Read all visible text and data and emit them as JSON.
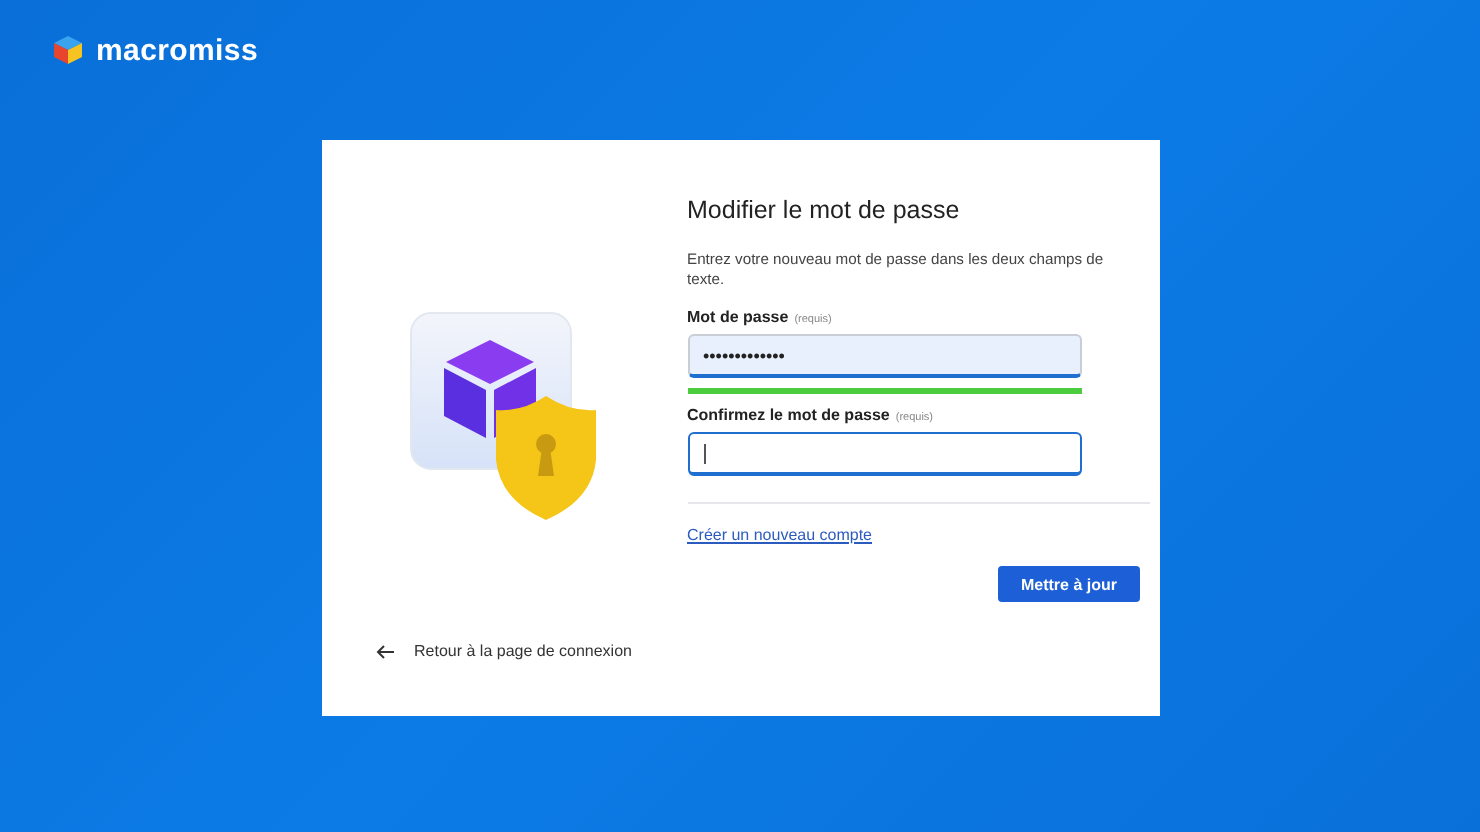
{
  "brand": {
    "name": "macromiss"
  },
  "form": {
    "title": "Modifier le mot de passe",
    "description": "Entrez votre nouveau mot de passe dans les deux champs de texte.",
    "fields": [
      {
        "label": "Mot de passe",
        "hint": "(requis)",
        "value": "•••••••••••••",
        "filled": true,
        "focused": false
      },
      {
        "label": "Confirmez le mot de passe",
        "hint": "(requis)",
        "filled": false,
        "focused": true
      }
    ],
    "strength": {
      "level": 1
    },
    "create_account_link": "Créer un nouveau compte",
    "submit_button": "Mettre à jour"
  },
  "back_link": "Retour à la page de connexion"
}
